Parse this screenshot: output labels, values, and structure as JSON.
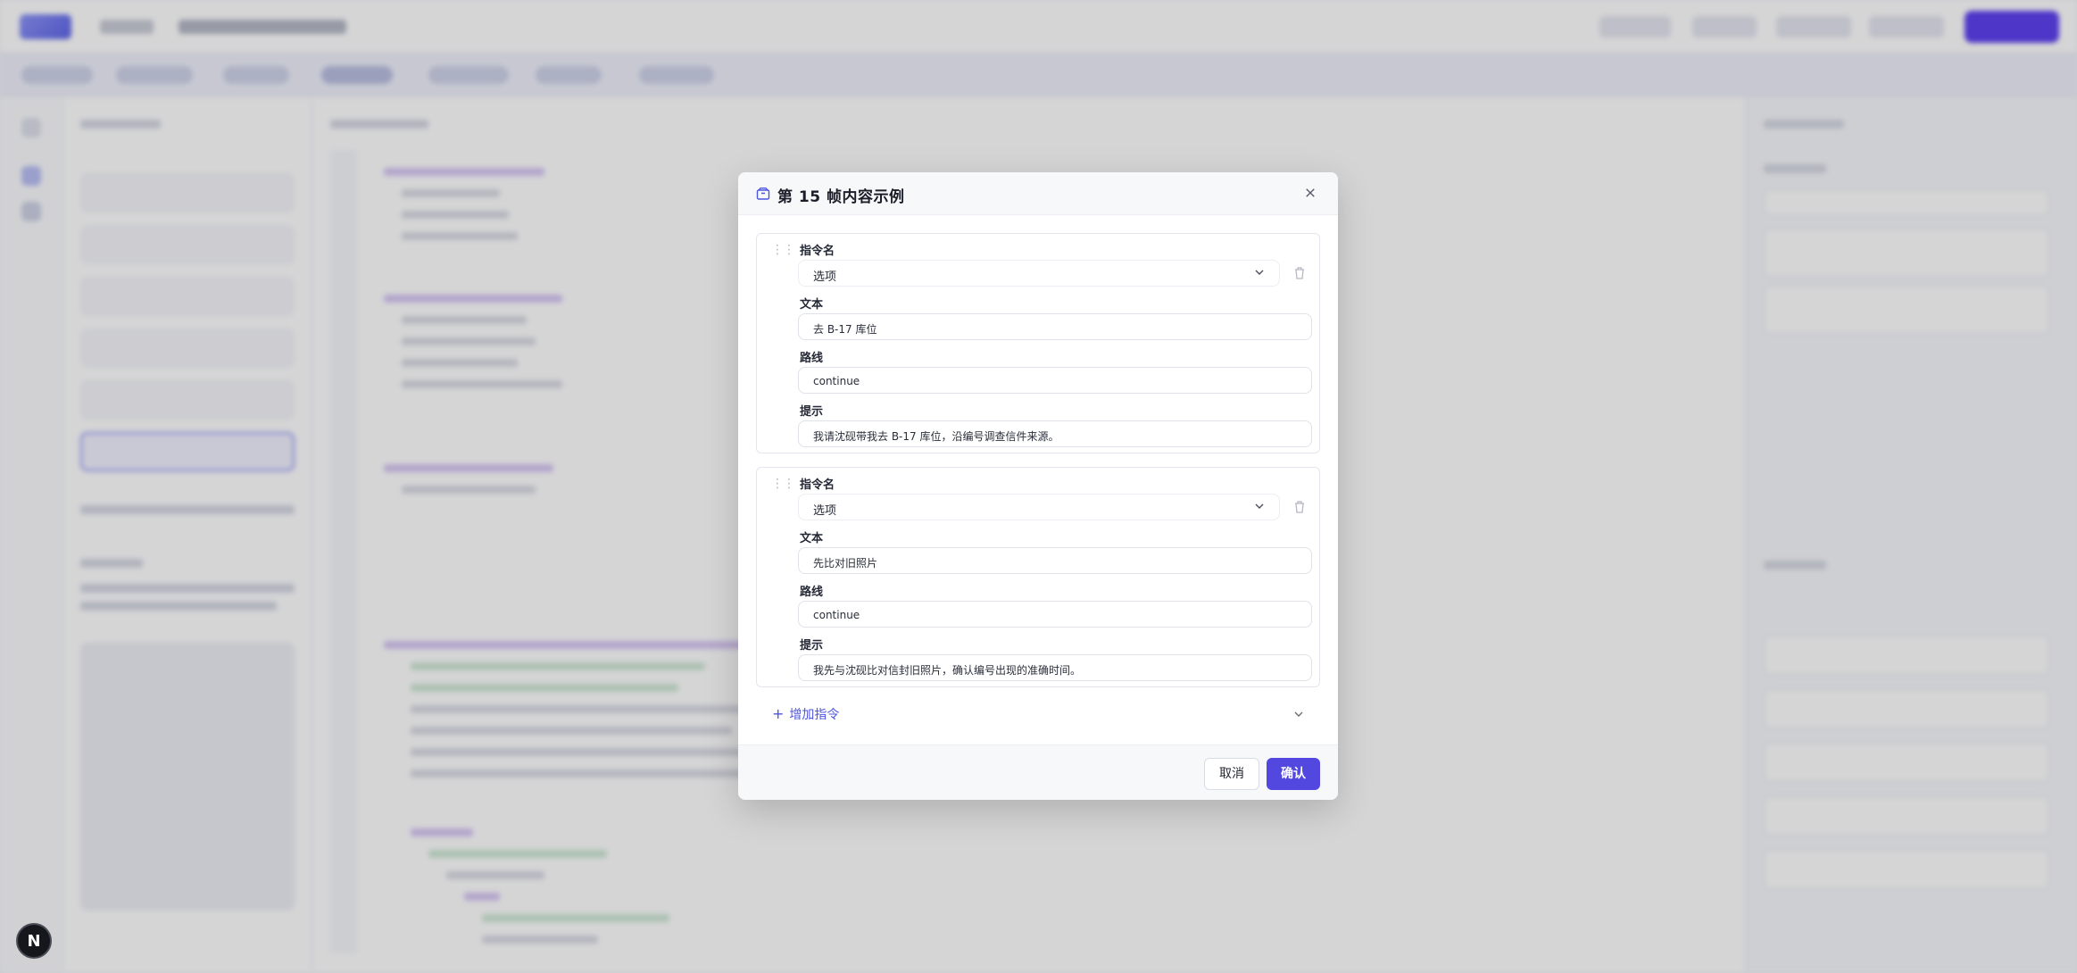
{
  "modal": {
    "title": "第 15 帧内容示例",
    "commands": [
      {
        "name_label": "指令名",
        "name_value": "选项",
        "text_label": "文本",
        "text_value": "去 B-17 库位",
        "route_label": "路线",
        "route_value": "continue",
        "hint_label": "提示",
        "hint_value": "我请沈砚带我去 B-17 库位，沿编号调查信件来源。"
      },
      {
        "name_label": "指令名",
        "name_value": "选项",
        "text_label": "文本",
        "text_value": "先比对旧照片",
        "route_label": "路线",
        "route_value": "continue",
        "hint_label": "提示",
        "hint_value": "我先与沈砚比对信封旧照片，确认编号出现的准确时间。"
      }
    ],
    "add_command_label": "增加指令",
    "cancel_label": "取消",
    "confirm_label": "确认"
  },
  "badge": {
    "letter": "N"
  },
  "colors": {
    "accent": "#5248e0",
    "overlay": "rgba(20,22,30,0.18)"
  }
}
